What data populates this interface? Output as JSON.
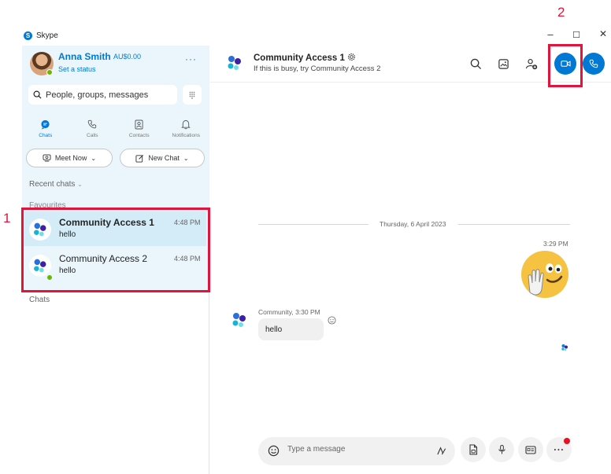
{
  "app": {
    "title": "Skype"
  },
  "window_controls": {
    "minimize": "–",
    "maximize": "☐",
    "close": "✕"
  },
  "profile": {
    "name": "Anna Smith",
    "credit": "AU$0.00",
    "status": "Set a status",
    "more": "···"
  },
  "search": {
    "placeholder": "People, groups, messages"
  },
  "nav": {
    "chats": "Chats",
    "calls": "Calls",
    "contacts": "Contacts",
    "notifications": "Notifications"
  },
  "actions": {
    "meet_now": "Meet Now",
    "new_chat": "New Chat"
  },
  "sections": {
    "recent": "Recent chats",
    "favourites": "Favourites",
    "chats": "Chats"
  },
  "favourites": [
    {
      "name": "Community Access 1",
      "preview": "hello",
      "time": "4:48 PM"
    },
    {
      "name": "Community Access 2",
      "preview": "hello",
      "time": "4:48 PM"
    }
  ],
  "conversation": {
    "title": "Community Access 1",
    "subtitle": "If this is busy, try Community Access 2",
    "date_separator": "Thursday, 6 April 2023",
    "outgoing_time": "3:29 PM",
    "incoming_meta": "Community, 3:30 PM",
    "incoming_text": "hello"
  },
  "composer": {
    "placeholder": "Type a message",
    "more": "···"
  },
  "annotations": {
    "label_1": "1",
    "label_2": "2",
    "color": "#e3133b"
  },
  "colors": {
    "accent": "#0078d4",
    "profile_bg": "#eaf6fb",
    "selected": "#d3ecf7",
    "online": "#6bb700"
  }
}
